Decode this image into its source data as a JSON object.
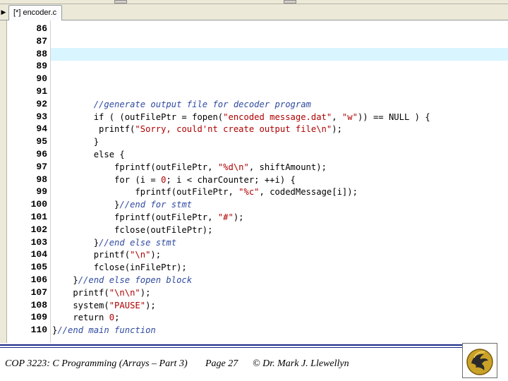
{
  "tab": {
    "label": "[*] encoder.c"
  },
  "editor": {
    "highlighted_line": "88",
    "lines": [
      {
        "n": "86",
        "tokens": []
      },
      {
        "n": "87",
        "tokens": []
      },
      {
        "n": "88",
        "tokens": []
      },
      {
        "n": "89",
        "tokens": []
      },
      {
        "n": "90",
        "tokens": []
      },
      {
        "n": "91",
        "tokens": []
      },
      {
        "n": "92",
        "tokens": [
          [
            "p",
            "        "
          ],
          [
            "c",
            "//generate output file for decoder program"
          ]
        ]
      },
      {
        "n": "93",
        "tokens": [
          [
            "p",
            "        if ( (outFilePtr = fopen("
          ],
          [
            "s",
            "\"encoded message.dat\""
          ],
          [
            "p",
            ", "
          ],
          [
            "s",
            "\"w\""
          ],
          [
            "p",
            ")) == NULL ) {"
          ]
        ]
      },
      {
        "n": "94",
        "tokens": [
          [
            "p",
            "         printf("
          ],
          [
            "s",
            "\"Sorry, could'nt create output file\\n\""
          ],
          [
            "p",
            ");"
          ]
        ]
      },
      {
        "n": "95",
        "tokens": [
          [
            "p",
            "        }"
          ]
        ]
      },
      {
        "n": "96",
        "tokens": [
          [
            "p",
            "        else {"
          ]
        ]
      },
      {
        "n": "97",
        "tokens": [
          [
            "p",
            "            fprintf(outFilePtr, "
          ],
          [
            "s",
            "\"%d\\n\""
          ],
          [
            "p",
            ", shiftAmount);"
          ]
        ]
      },
      {
        "n": "98",
        "tokens": [
          [
            "p",
            "            for (i = "
          ],
          [
            "n",
            "0"
          ],
          [
            "p",
            "; i < charCounter; ++i) {"
          ]
        ]
      },
      {
        "n": "99",
        "tokens": [
          [
            "p",
            "                fprintf(outFilePtr, "
          ],
          [
            "s",
            "\"%c\""
          ],
          [
            "p",
            ", codedMessage[i]);"
          ]
        ]
      },
      {
        "n": "100",
        "tokens": [
          [
            "p",
            "            }"
          ],
          [
            "c",
            "//end for stmt"
          ]
        ]
      },
      {
        "n": "101",
        "tokens": [
          [
            "p",
            "            fprintf(outFilePtr, "
          ],
          [
            "s",
            "\"#\""
          ],
          [
            "p",
            ");"
          ]
        ]
      },
      {
        "n": "102",
        "tokens": [
          [
            "p",
            "            fclose(outFilePtr);"
          ]
        ]
      },
      {
        "n": "103",
        "tokens": [
          [
            "p",
            "        }"
          ],
          [
            "c",
            "//end else stmt"
          ]
        ]
      },
      {
        "n": "104",
        "tokens": [
          [
            "p",
            "        printf("
          ],
          [
            "s",
            "\"\\n\""
          ],
          [
            "p",
            ");"
          ]
        ]
      },
      {
        "n": "105",
        "tokens": [
          [
            "p",
            "        fclose(inFilePtr);"
          ]
        ]
      },
      {
        "n": "106",
        "tokens": [
          [
            "p",
            "    }"
          ],
          [
            "c",
            "//end else fopen block"
          ]
        ]
      },
      {
        "n": "107",
        "tokens": [
          [
            "p",
            "    printf("
          ],
          [
            "s",
            "\"\\n\\n\""
          ],
          [
            "p",
            ");"
          ]
        ]
      },
      {
        "n": "108",
        "tokens": [
          [
            "p",
            "    system("
          ],
          [
            "s",
            "\"PAUSE\""
          ],
          [
            "p",
            ");"
          ]
        ]
      },
      {
        "n": "109",
        "tokens": [
          [
            "p",
            "    return "
          ],
          [
            "n",
            "0"
          ],
          [
            "p",
            ";"
          ]
        ]
      },
      {
        "n": "110",
        "tokens": [
          [
            "p",
            "}"
          ],
          [
            "c",
            "//end main function"
          ]
        ]
      }
    ]
  },
  "footer": {
    "course": "COP 3223: C Programming (Arrays – Part 3)",
    "page": "Page 27",
    "author": "© Dr. Mark J. Llewellyn"
  },
  "colors": {
    "comment": "#2f4aa0",
    "string": "#b00000",
    "highlight": "#d9f5ff",
    "rule": "#1a2a8a"
  },
  "icons": {
    "tab_scroll": "triangle-right",
    "logo": "ucf-pegasus-logo"
  }
}
